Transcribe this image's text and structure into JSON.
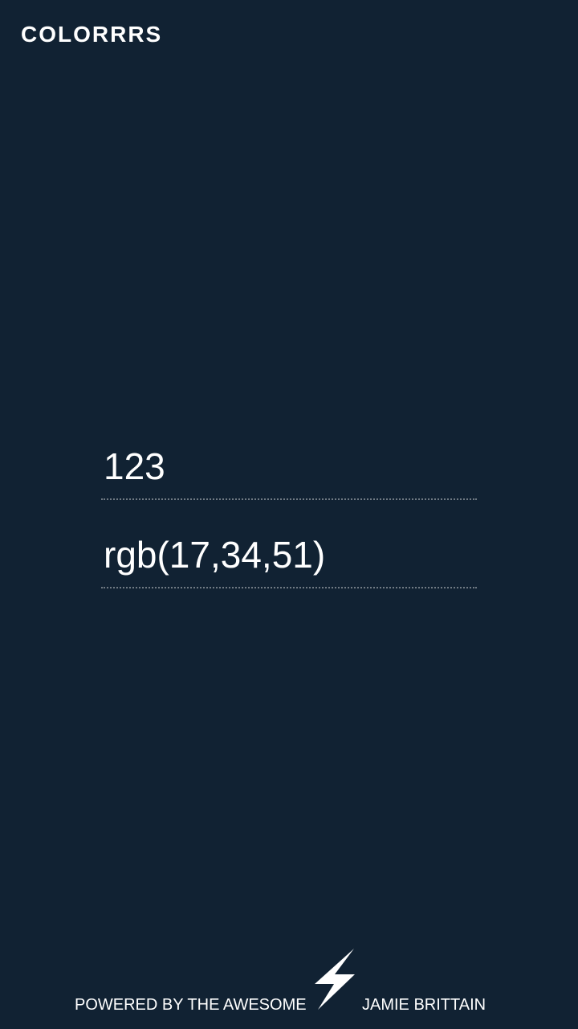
{
  "app": {
    "name": "COLORRRS",
    "background_color": "#112233"
  },
  "color_form": {
    "hex_value": "123",
    "rgb_value": "rgb(17,34,51)"
  },
  "footer": {
    "powered_by": "POWERED BY THE AWESOME",
    "icon": "lightning-bolt-icon",
    "author": "JAMIE BRITTAIN"
  }
}
